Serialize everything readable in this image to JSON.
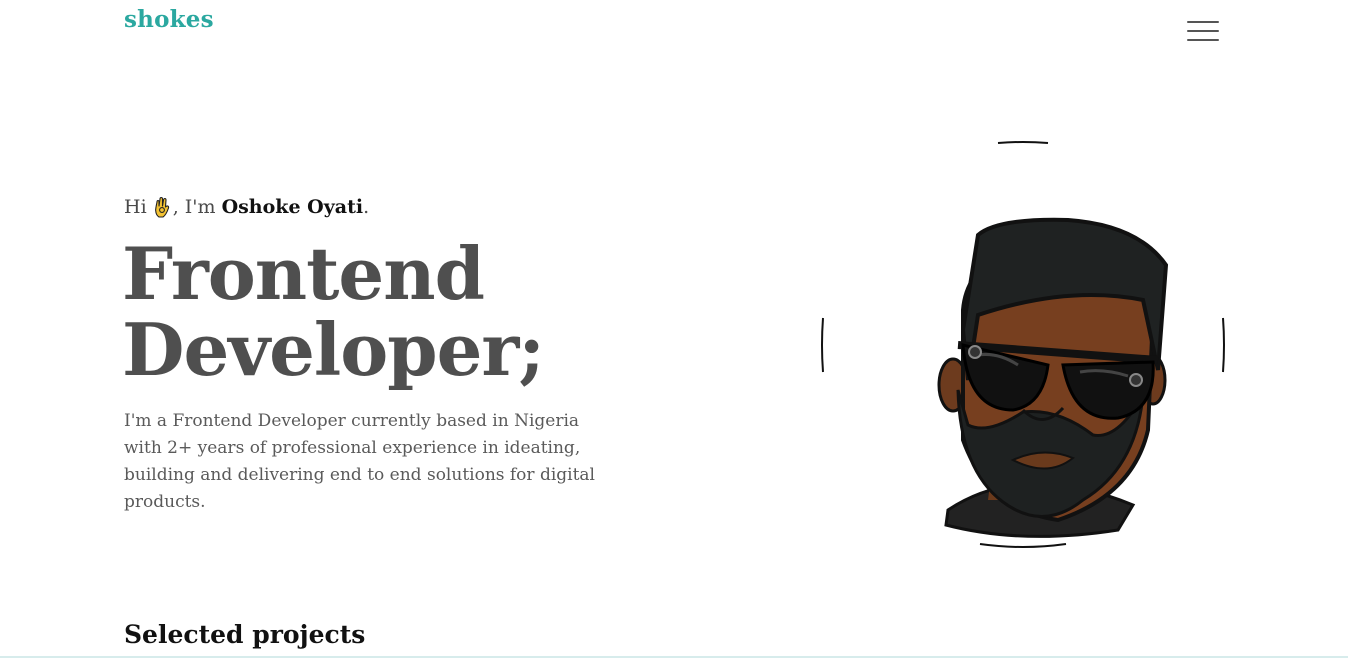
{
  "header": {
    "logo": "shokes",
    "menu_icon": "hamburger-menu-icon"
  },
  "hero": {
    "greeting_prefix": "Hi ",
    "greeting_emoji_icon": "ok-hand-icon",
    "greeting_mid": ", I'm ",
    "name": "Oshoke Oyati",
    "greeting_suffix": ".",
    "headline_line1": "Frontend",
    "headline_line2": "Developer;",
    "intro": "I'm a Frontend Developer currently based in Nigeria with 2+ years of professional experience in ideating, building and delivering end to end solutions for digital products.",
    "avatar_icon": "bitmoji-avatar"
  },
  "projects": {
    "title": "Selected projects"
  },
  "colors": {
    "brand": "#2ba8a0",
    "headline": "#4f4f4f",
    "body_text": "#5a5a5a"
  }
}
